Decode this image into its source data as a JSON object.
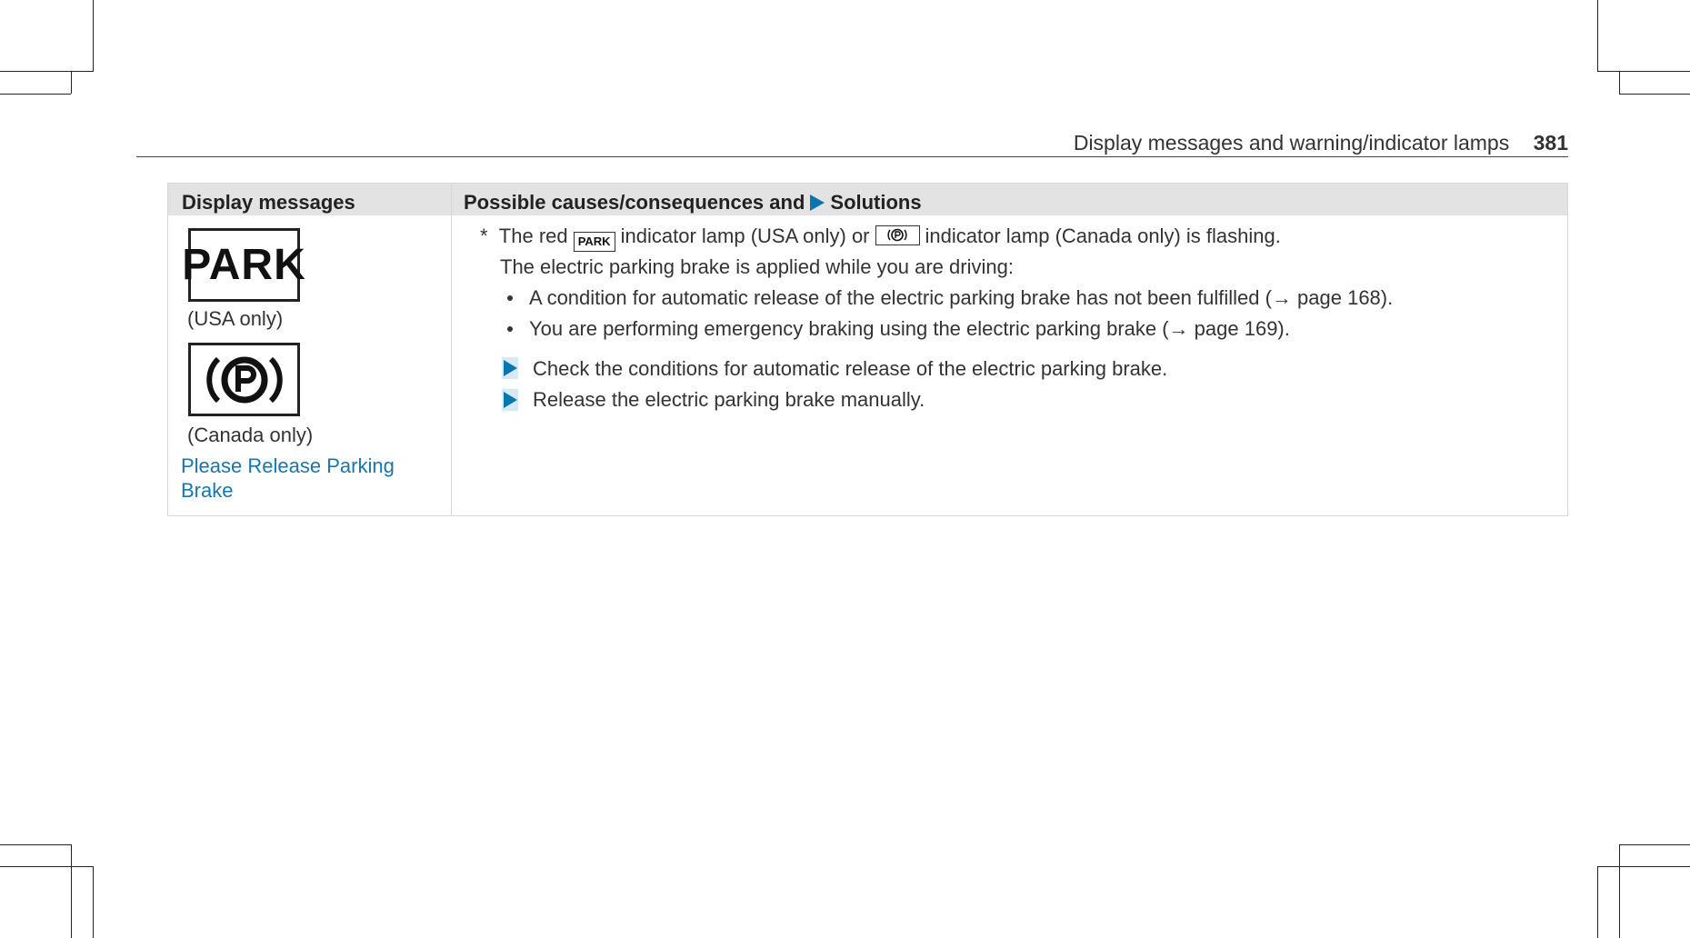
{
  "running_head": {
    "title": "Display messages and warning/indicator lamps",
    "page_number": "381"
  },
  "table": {
    "header": {
      "col1": "Display messages",
      "col2_prefix": "Possible causes/consequences and",
      "col2_suffix": "Solutions"
    },
    "left": {
      "park_symbol": "PARK",
      "usa_caption": "(USA only)",
      "canada_caption": "(Canada only)",
      "message": "Please Release Parking Brake"
    },
    "right": {
      "line1_star": "*",
      "line1_a": "The red",
      "line1_park_icon": "PARK",
      "line1_b": "indicator lamp (USA only) or",
      "line1_c": "indicator lamp (Canada only) is flashing.",
      "line2": "The electric parking brake is applied while you are driving:",
      "bullets": [
        "A condition for automatic release of the electric parking brake has not been fulfilled (→ page 168).",
        "You are performing emergency braking using the electric parking brake (→ page 169)."
      ],
      "solutions": [
        "Check the conditions for automatic release of the electric parking brake.",
        "Release the electric parking brake manually."
      ]
    }
  },
  "colors": {
    "accent_blue": "#0b75b0",
    "message_blue": "#1a75ad",
    "header_gray": "#e3e3e3"
  },
  "icons": [
    "crop-mark-icon",
    "park-lamp-icon",
    "parking-brake-p-icon",
    "solution-arrow-icon"
  ]
}
